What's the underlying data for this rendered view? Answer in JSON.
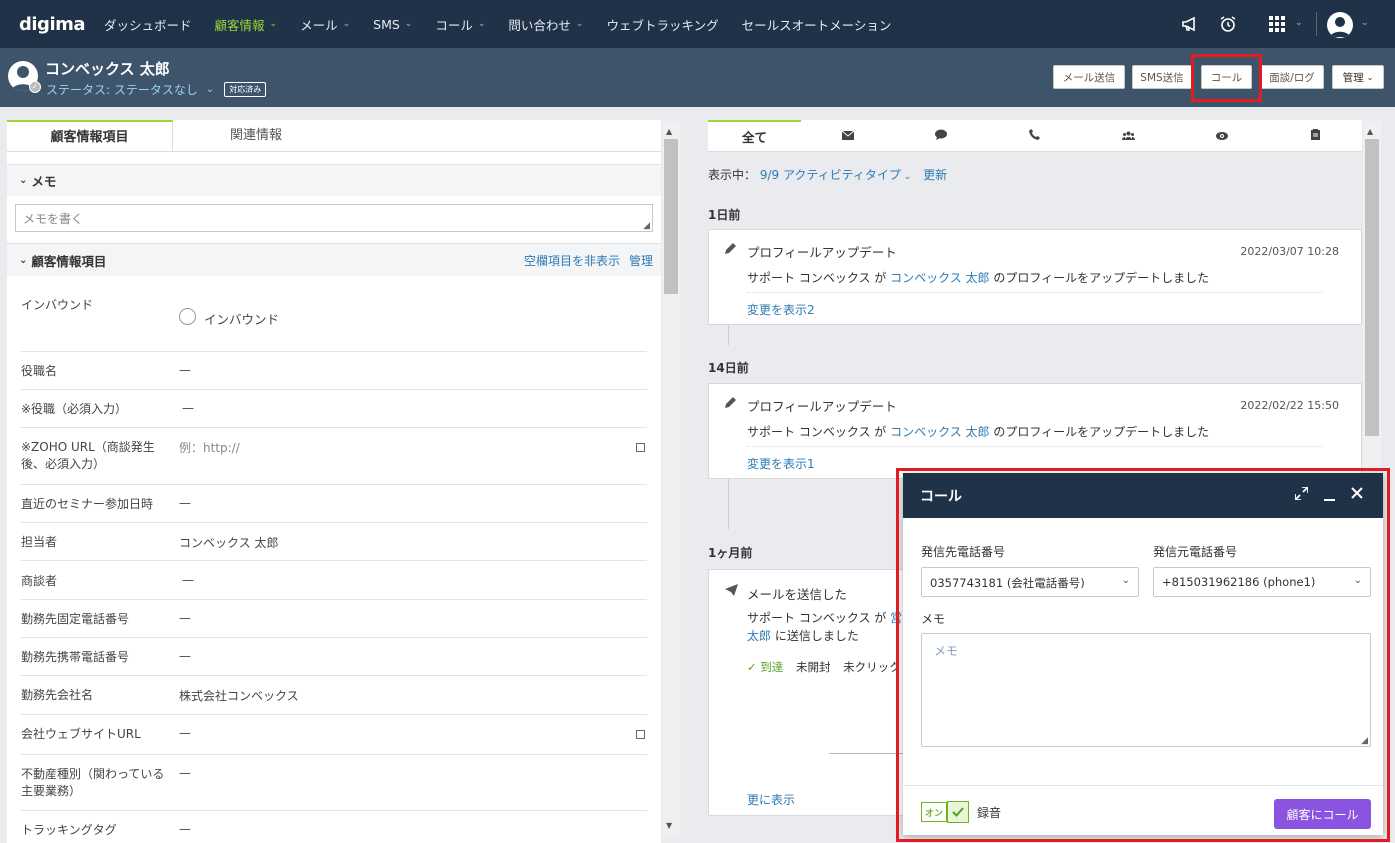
{
  "nav": {
    "logo": "digima",
    "items": [
      {
        "label": "ダッシュボード",
        "dropdown": false,
        "active": false
      },
      {
        "label": "顧客情報",
        "dropdown": true,
        "active": true
      },
      {
        "label": "メール",
        "dropdown": true,
        "active": false
      },
      {
        "label": "SMS",
        "dropdown": true,
        "active": false
      },
      {
        "label": "コール",
        "dropdown": true,
        "active": false
      },
      {
        "label": "問い合わせ",
        "dropdown": true,
        "active": false
      },
      {
        "label": "ウェブトラッキング",
        "dropdown": false,
        "active": false
      },
      {
        "label": "セールスオートメーション",
        "dropdown": false,
        "active": false
      }
    ],
    "icons": [
      "megaphone-icon",
      "alarm-clock-icon",
      "app-grid-icon",
      "user-avatar-icon"
    ]
  },
  "customer": {
    "name": "コンベックス 太郎",
    "status": "ステータス: ステータスなし",
    "badge": "対応済み"
  },
  "header_buttons": {
    "email": "メール送信",
    "sms": "SMS送信",
    "call": "コール",
    "meeting": "面談/ログ",
    "manage": "管理"
  },
  "left": {
    "tabs": [
      "顧客情報項目",
      "関連情報"
    ],
    "memo": {
      "title": "メモ",
      "placeholder": "メモを書く"
    },
    "fields_section": {
      "title": "顧客情報項目",
      "hide_empty": "空欄項目を非表示",
      "manage": "管理"
    },
    "fields": [
      {
        "label": "インバウンド",
        "value": "インバウンド"
      },
      {
        "label": "役職名",
        "value": "—"
      },
      {
        "label": "※役職（必須入力）",
        "value": "—"
      },
      {
        "label": "※ZOHO URL（商談発生後、必須入力）",
        "value": "例：http://"
      },
      {
        "label": "直近のセミナー参加日時",
        "value": "—"
      },
      {
        "label": "担当者",
        "value": "コンベックス 太郎"
      },
      {
        "label": "商談者",
        "value": "—"
      },
      {
        "label": "勤務先固定電話番号",
        "value": "—"
      },
      {
        "label": "勤務先携帯電話番号",
        "value": "—"
      },
      {
        "label": "勤務先会社名",
        "value": "株式会社コンベックス"
      },
      {
        "label": "会社ウェブサイトURL",
        "value": "—"
      },
      {
        "label": "不動産種別（関わっている主要業務）",
        "value": "—"
      },
      {
        "label": "トラッキングタグ",
        "value": "—"
      }
    ]
  },
  "right": {
    "tabs": [
      "全て",
      "mail-icon",
      "chat-icon",
      "phone-icon",
      "group-icon",
      "eye-icon",
      "clipboard-icon"
    ],
    "filter_label": "表示中：",
    "filter_value": "9/9 アクティビティタイプ",
    "refresh": "更新",
    "groups": [
      {
        "label": "1日前"
      },
      {
        "label": "14日前"
      },
      {
        "label": "1ヶ月前"
      }
    ],
    "activities": [
      {
        "title": "プロフィールアップデート",
        "date": "2022/03/07 10:28",
        "desc_pre": "サポート コンベックス が ",
        "desc_link": "コンベックス 太郎",
        "desc_post": " のプロフィールをアップデートしました",
        "more": "変更を表示2"
      },
      {
        "title": "プロフィールアップデート",
        "date": "2022/02/22 15:50",
        "desc_pre": "サポート コンベックス が ",
        "desc_link": "コンベックス 太郎",
        "desc_post": " のプロフィールをアップデートしました",
        "more": "変更を表示1"
      },
      {
        "title": "メールを送信した",
        "desc_pre": "サポート コンベックス が ",
        "desc_link": "営",
        "desc_line2_link": "太郎",
        "desc_line2_post": " に送信しました",
        "statuses": [
          "✓ 到達",
          "未開封",
          "未クリック"
        ],
        "more": "更に表示"
      }
    ]
  },
  "call_modal": {
    "title": "コール",
    "to_label": "発信先電話番号",
    "to_value": "0357743181 (会社電話番号)",
    "from_label": "発信元電話番号",
    "from_value": "+815031962186 (phone1)",
    "memo_label": "メモ",
    "memo_placeholder": "メモ",
    "toggle_on": "オン",
    "record_label": "録音",
    "call_button": "顧客にコール"
  },
  "colors": {
    "nav_bg": "#1f3247",
    "sub_bg": "#3d546b",
    "accent_green": "#9bd53a",
    "link": "#2d7ab5",
    "call_purple": "#8b54e0",
    "highlight_red": "#e11d22"
  }
}
